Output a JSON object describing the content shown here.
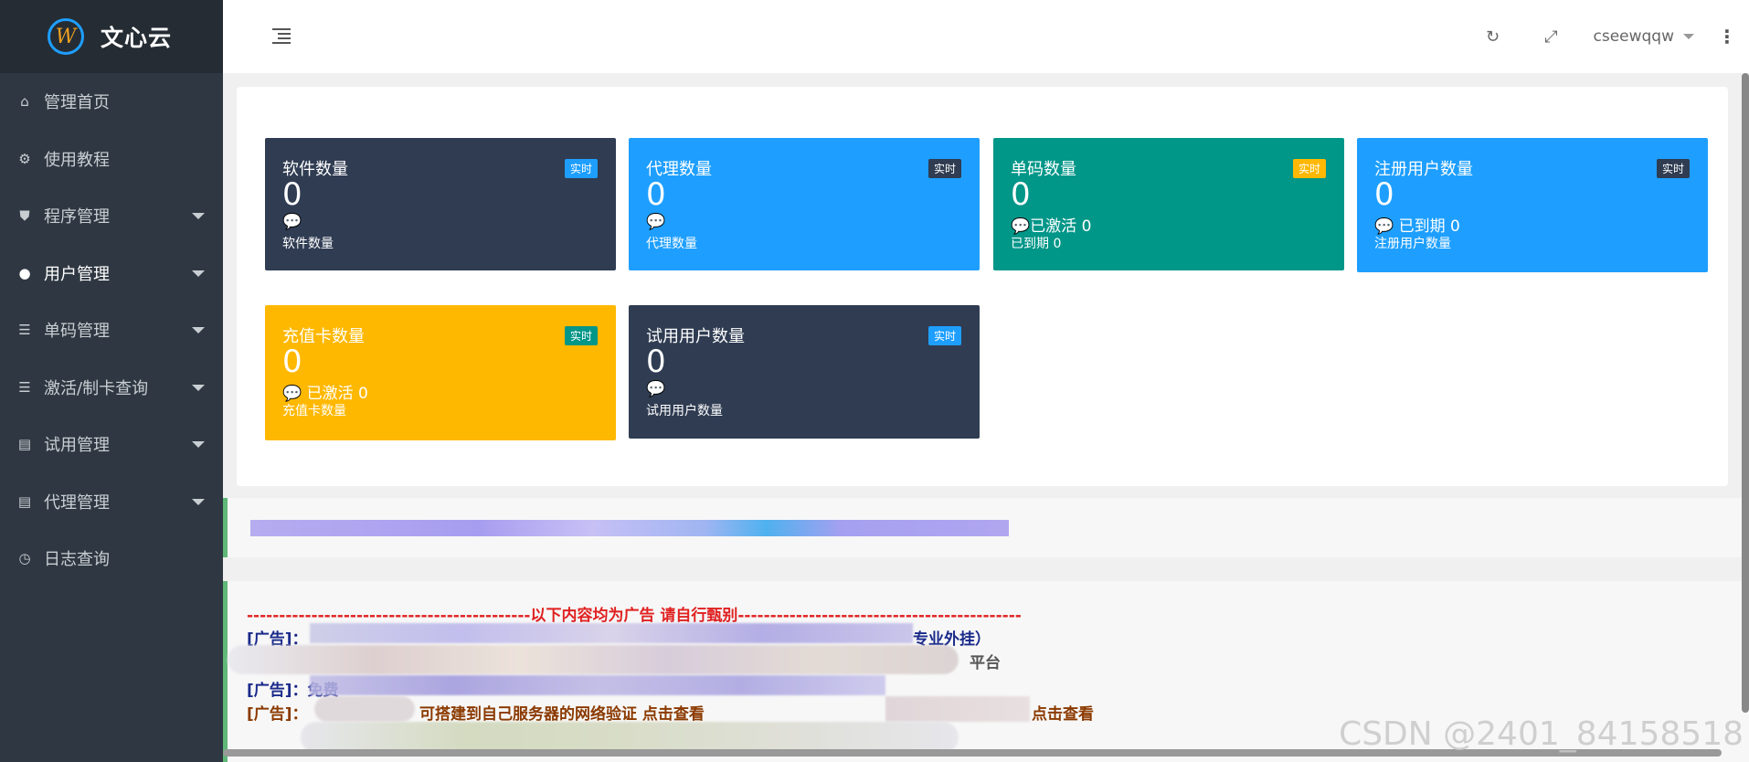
{
  "app": {
    "brand": "文心云",
    "logo_letter": "W"
  },
  "sidebar": {
    "items": [
      {
        "label": "管理首页",
        "icon": "home-icon",
        "glyph": "⌂",
        "has_caret": false
      },
      {
        "label": "使用教程",
        "icon": "gear-icon",
        "glyph": "⚙",
        "has_caret": false
      },
      {
        "label": "程序管理",
        "icon": "shield-icon",
        "glyph": "⛊",
        "has_caret": true
      },
      {
        "label": "用户管理",
        "icon": "user-icon",
        "glyph": "●",
        "has_caret": true,
        "active": true
      },
      {
        "label": "单码管理",
        "icon": "list-icon",
        "glyph": "☰",
        "has_caret": true
      },
      {
        "label": "激活/制卡查询",
        "icon": "list-icon",
        "glyph": "☰",
        "has_caret": true
      },
      {
        "label": "试用管理",
        "icon": "document-icon",
        "glyph": "▤",
        "has_caret": true
      },
      {
        "label": "代理管理",
        "icon": "document-icon",
        "glyph": "▤",
        "has_caret": true
      },
      {
        "label": "日志查询",
        "icon": "clock-icon",
        "glyph": "◷",
        "has_caret": false
      }
    ]
  },
  "header": {
    "refresh_glyph": "↻",
    "fullscreen_glyph": "⤢",
    "username": "cseewqqw",
    "more_glyph": "⋮"
  },
  "cards": [
    {
      "title": "软件数量",
      "badge": "实时",
      "value": "0",
      "sub1": "💬",
      "sub2": "软件数量",
      "bg": "#2f3c52",
      "badge_bg": "#1e9fff"
    },
    {
      "title": "代理数量",
      "badge": "实时",
      "value": "0",
      "sub1": "💬",
      "sub2": "代理数量",
      "bg": "#1e9fff",
      "badge_bg": "#2f3c52"
    },
    {
      "title": "单码数量",
      "badge": "实时",
      "value": "0",
      "sub1": "💬已激活 0",
      "sub2": "已到期 0",
      "bg": "#009688",
      "badge_bg": "#ffb800"
    },
    {
      "title": "注册用户数量",
      "badge": "实时",
      "value": "0",
      "sub1": "💬 已到期 0",
      "sub2": "注册用户数量",
      "bg": "#1e9fff",
      "badge_bg": "#2f3c52"
    },
    {
      "title": "充值卡数量",
      "badge": "实时",
      "value": "0",
      "sub1": "💬 已激活 0",
      "sub2": "充值卡数量",
      "bg": "#ffb800",
      "badge_bg": "#009688"
    },
    {
      "title": "试用用户数量",
      "badge": "实时",
      "value": "0",
      "sub1": "💬",
      "sub2": "试用用户数量",
      "bg": "#2f3c52",
      "badge_bg": "#1e9fff"
    }
  ],
  "ads": {
    "header": "--------------------------------------------以下内容均为广告 请自行甄别--------------------------------------------",
    "line1_prefix": "[广告]：",
    "line3_prefix": "[广告]：免费",
    "line4_prefix": "[广告]：",
    "line4_tail": "可搭建到自己服务器的网络验证 点击查看",
    "line4_end": "点击查看",
    "line1_tail": "专业外挂）",
    "line2_tail": "平台"
  },
  "watermark": "CSDN @2401_84158518"
}
